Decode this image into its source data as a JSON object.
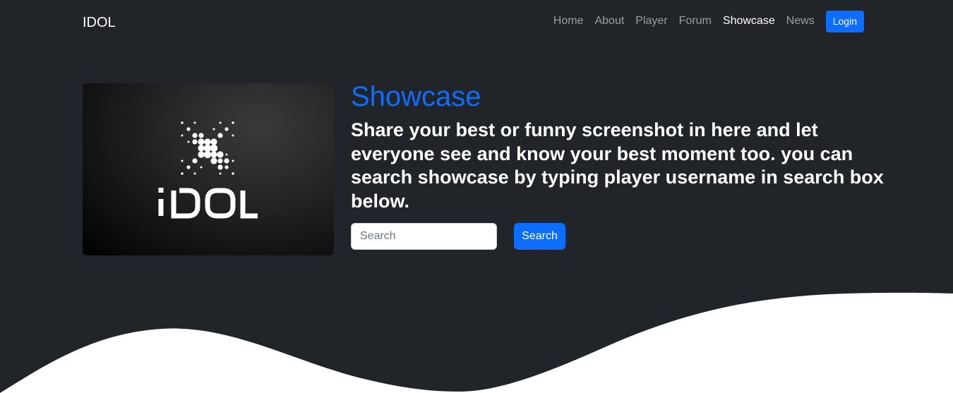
{
  "navbar": {
    "brand": "IDOL",
    "links": [
      {
        "label": "Home"
      },
      {
        "label": "About"
      },
      {
        "label": "Player"
      },
      {
        "label": "Forum"
      },
      {
        "label": "Showcase",
        "active": true
      },
      {
        "label": "News"
      }
    ],
    "login_label": "Login"
  },
  "hero": {
    "image_logo_text": "IDOL",
    "title": "Showcase",
    "lead": "Share your best or funny screenshot in here and let everyone see and know your best moment too. you can search showcase by typing player username in search box below.",
    "search": {
      "placeholder": "Search",
      "value": "",
      "button_label": "Search"
    }
  },
  "colors": {
    "background": "#212529",
    "accent": "#0d6efd",
    "wave": "#ffffff"
  }
}
